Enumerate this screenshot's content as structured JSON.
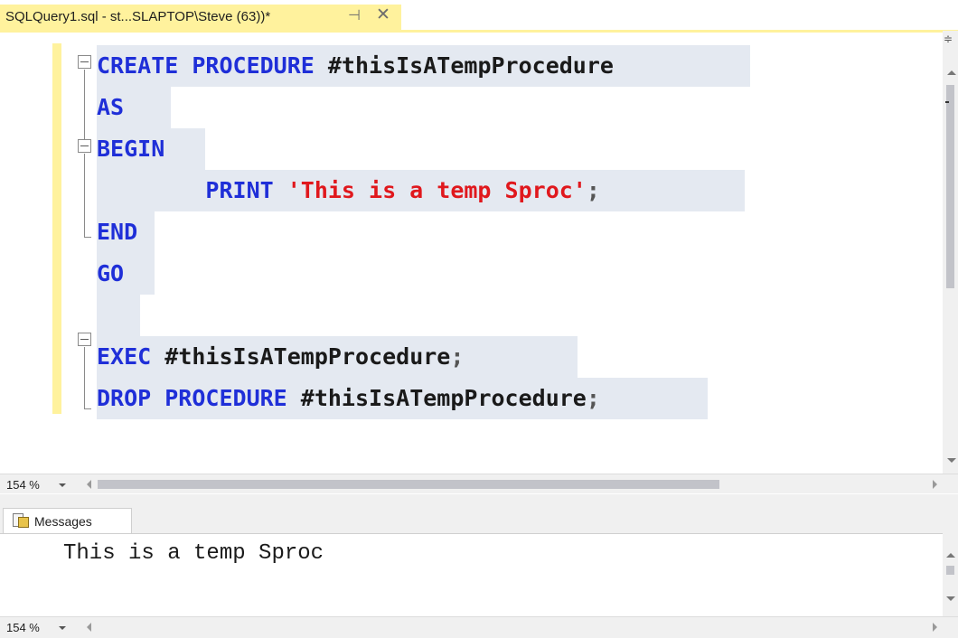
{
  "tab": {
    "title": "SQLQuery1.sql - st...SLAPTOP\\Steve (63))*",
    "pin_glyph": "⊣",
    "close_glyph": "✕"
  },
  "code": [
    [
      {
        "t": "CREATE PROCEDURE ",
        "c": "kw"
      },
      {
        "t": "#thisIsATempProcedure",
        "c": "tx"
      }
    ],
    [
      {
        "t": "AS",
        "c": "kw"
      }
    ],
    [
      {
        "t": "BEGIN",
        "c": "kw"
      }
    ],
    [
      {
        "t": "        PRINT ",
        "c": "kw"
      },
      {
        "t": "'This is a temp Sproc'",
        "c": "str"
      },
      {
        "t": ";",
        "c": "pun"
      }
    ],
    [
      {
        "t": "END",
        "c": "kw"
      }
    ],
    [
      {
        "t": "GO",
        "c": "kw"
      }
    ],
    [],
    [
      {
        "t": "EXEC ",
        "c": "kw"
      },
      {
        "t": "#thisIsATempProcedure",
        "c": "tx"
      },
      {
        "t": ";",
        "c": "pun"
      }
    ],
    [
      {
        "t": "DROP PROCEDURE ",
        "c": "kw"
      },
      {
        "t": "#thisIsATempProcedure",
        "c": "tx"
      },
      {
        "t": ";",
        "c": "pun"
      }
    ]
  ],
  "editor_zoom": "154 %",
  "results": {
    "tab_label": "Messages",
    "message": "This is a temp Sproc",
    "zoom": "154 %"
  }
}
